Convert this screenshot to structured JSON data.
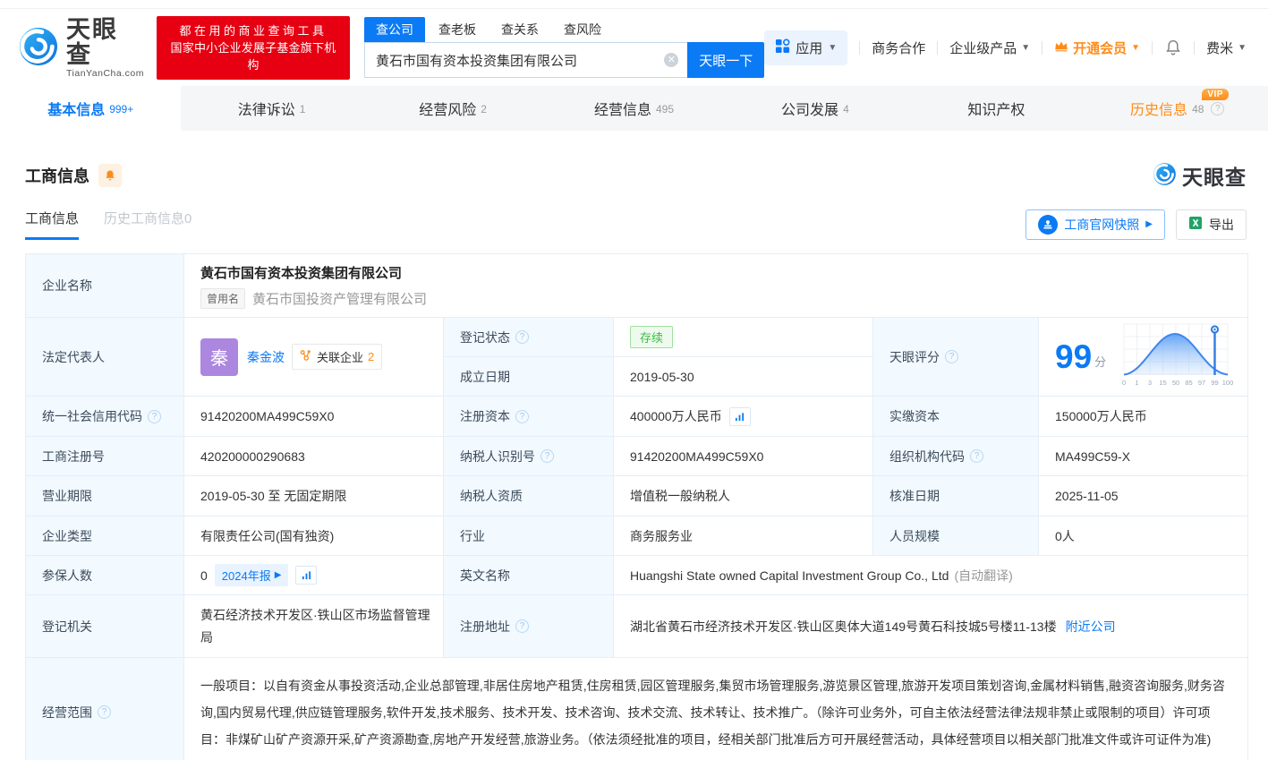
{
  "colors": {
    "accent": "#0b7af5",
    "brand_red": "#e60012",
    "orange": "#ff8c19",
    "status_green": "#3dbb42"
  },
  "header": {
    "logo": {
      "brand": "天眼查",
      "domain": "TianYanCha.com"
    },
    "banner": {
      "line1": "都在用的商业查询工具",
      "line2": "国家中小企业发展子基金旗下机构"
    },
    "search": {
      "tabs": [
        {
          "label": "查公司"
        },
        {
          "label": "查老板"
        },
        {
          "label": "查关系"
        },
        {
          "label": "查风险"
        }
      ],
      "value": "黄石市国有资本投资集团有限公司",
      "button": "天眼一下"
    },
    "nav": {
      "apps": "应用",
      "biz": "商务合作",
      "enterprise": "企业级产品",
      "vip": "开通会员",
      "user": "费米"
    }
  },
  "tabs": [
    {
      "label": "基本信息",
      "count": "999+"
    },
    {
      "label": "法律诉讼",
      "count": "1"
    },
    {
      "label": "经营风险",
      "count": "2"
    },
    {
      "label": "经营信息",
      "count": "495"
    },
    {
      "label": "公司发展",
      "count": "4"
    },
    {
      "label": "知识产权",
      "count": ""
    },
    {
      "label": "历史信息",
      "count": "48",
      "badge": "VIP"
    }
  ],
  "section": {
    "title": "工商信息",
    "watermark": "天眼查",
    "subtabs": [
      {
        "label": "工商信息"
      },
      {
        "label": "历史工商信息0"
      }
    ],
    "snapshot_button": "工商官网快照",
    "export_button": "导出"
  },
  "table": {
    "company_name": {
      "label": "企业名称",
      "value": "黄石市国有资本投资集团有限公司",
      "former_badge": "曾用名",
      "former_name": "黄石市国投资产管理有限公司"
    },
    "legal_rep": {
      "label": "法定代表人",
      "avatar": "秦",
      "name": "秦金波",
      "related_label": "关联企业",
      "related_count": "2"
    },
    "reg_status": {
      "label": "登记状态",
      "value": "存续"
    },
    "est_date": {
      "label": "成立日期",
      "value": "2019-05-30"
    },
    "score": {
      "label": "天眼评分",
      "value": "99",
      "unit": "分",
      "axis": [
        "0",
        "1",
        "3",
        "15",
        "50",
        "85",
        "97",
        "99",
        "100"
      ]
    },
    "uscc": {
      "label": "统一社会信用代码",
      "value": "91420200MA499C59X0"
    },
    "reg_capital": {
      "label": "注册资本",
      "value": "400000万人民币"
    },
    "paid_capital": {
      "label": "实缴资本",
      "value": "150000万人民币"
    },
    "reg_number": {
      "label": "工商注册号",
      "value": "420200000290683"
    },
    "taxpayer_id": {
      "label": "纳税人识别号",
      "value": "91420200MA499C59X0"
    },
    "org_code": {
      "label": "组织机构代码",
      "value": "MA499C59-X"
    },
    "business_term": {
      "label": "营业期限",
      "value": "2019-05-30 至 无固定期限"
    },
    "taxpayer_quality": {
      "label": "纳税人资质",
      "value": "增值税一般纳税人"
    },
    "approval_date": {
      "label": "核准日期",
      "value": "2025-11-05"
    },
    "company_type": {
      "label": "企业类型",
      "value": "有限责任公司(国有独资)"
    },
    "industry": {
      "label": "行业",
      "value": "商务服务业"
    },
    "staff_size": {
      "label": "人员规模",
      "value": "0人"
    },
    "insured": {
      "label": "参保人数",
      "value": "0",
      "report_badge": "2024年报"
    },
    "english_name": {
      "label": "英文名称",
      "value": "Huangshi State owned Capital Investment Group Co., Ltd",
      "note": "(自动翻译)"
    },
    "reg_authority": {
      "label": "登记机关",
      "value": "黄石经济技术开发区·铁山区市场监督管理局"
    },
    "reg_address": {
      "label": "注册地址",
      "value": "湖北省黄石市经济技术开发区·铁山区奥体大道149号黄石科技城5号楼11-13楼",
      "link": "附近公司"
    },
    "business_scope": {
      "label": "经营范围",
      "value": "一般项目：以自有资金从事投资活动,企业总部管理,非居住房地产租赁,住房租赁,园区管理服务,集贸市场管理服务,游览景区管理,旅游开发项目策划咨询,金属材料销售,融资咨询服务,财务咨询,国内贸易代理,供应链管理服务,软件开发,技术服务、技术开发、技术咨询、技术交流、技术转让、技术推广。（除许可业务外，可自主依法经营法律法规非禁止或限制的项目）许可项目：非煤矿山矿产资源开采,矿产资源勘查,房地产开发经营,旅游业务。（依法须经批准的项目，经相关部门批准后方可开展经营活动，具体经营项目以相关部门批准文件或许可证件为准)"
    }
  }
}
